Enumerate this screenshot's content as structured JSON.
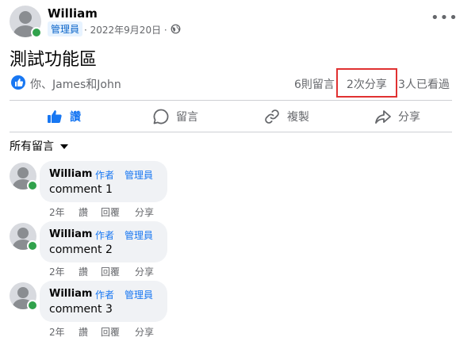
{
  "post": {
    "author": "William",
    "role_badge": "管理員",
    "date": "· 2022年9月20日 ·",
    "more_label": "•••",
    "text": "測試功能區",
    "reactors": "你、James和John",
    "comments_count": "6則留言",
    "shares_count": "2次分享",
    "views_count": "3人已看過",
    "highlight_color": "#e03131"
  },
  "actions": {
    "like": "讚",
    "comment": "留言",
    "copy": "複製",
    "share": "分享"
  },
  "comments_filter": "所有留言",
  "comments": [
    {
      "author": "William",
      "tag_author": "作者",
      "tag_admin": "管理員",
      "text": "comment 1",
      "time": "2年",
      "like": "讚",
      "reply": "回覆",
      "share": "分享"
    },
    {
      "author": "William",
      "tag_author": "作者",
      "tag_admin": "管理員",
      "text": "comment 2",
      "time": "2年",
      "like": "讚",
      "reply": "回覆",
      "share": "分享"
    },
    {
      "author": "William",
      "tag_author": "作者",
      "tag_admin": "管理員",
      "text": "comment 3",
      "time": "2年",
      "like": "讚",
      "reply": "回覆",
      "share": "分享"
    }
  ],
  "colors": {
    "accent": "#1877f2",
    "online": "#31a24c",
    "muted": "#65676b"
  }
}
